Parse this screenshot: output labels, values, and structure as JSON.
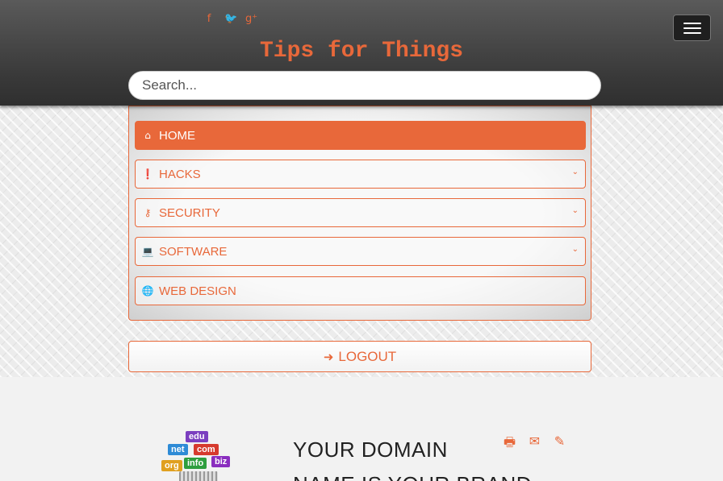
{
  "header": {
    "social": [
      {
        "name": "facebook",
        "glyph": "f"
      },
      {
        "name": "twitter",
        "glyph": "🐦"
      },
      {
        "name": "google-plus",
        "glyph": "g⁺"
      }
    ],
    "site_title": "Tips for Things",
    "search": {
      "placeholder": "Search...",
      "value": ""
    },
    "menu_icon": "hamburger-icon"
  },
  "nav": {
    "items": [
      {
        "label": "HOME",
        "icon": "home-icon",
        "glyph": "⌂",
        "active": true,
        "has_submenu": false
      },
      {
        "label": "HACKS",
        "icon": "exclamation-circle-icon",
        "glyph": "❗",
        "active": false,
        "has_submenu": true
      },
      {
        "label": "SECURITY",
        "icon": "key-icon",
        "glyph": "⚷",
        "active": false,
        "has_submenu": true
      },
      {
        "label": "SOFTWARE",
        "icon": "laptop-icon",
        "glyph": "💻",
        "active": false,
        "has_submenu": true
      },
      {
        "label": "WEB DESIGN",
        "icon": "globe-icon",
        "glyph": "🌐",
        "active": false,
        "has_submenu": false
      }
    ],
    "chevron": "⌄"
  },
  "logout": {
    "label": "LOGOUT",
    "glyph": "➜"
  },
  "article": {
    "title": "YOUR DOMAIN",
    "subtitle": "NAME IS YOUR BRAND",
    "thumb_tags": [
      "edu",
      "net",
      "com",
      "info",
      "biz",
      "org"
    ],
    "actions": [
      {
        "name": "print-icon",
        "glyph": "🖶"
      },
      {
        "name": "email-icon",
        "glyph": "✉"
      },
      {
        "name": "edit-icon",
        "glyph": "✎"
      }
    ]
  },
  "colors": {
    "accent": "#e8683a",
    "header_bg": "#3a3a3a",
    "page_bg": "#f2f2f2"
  }
}
